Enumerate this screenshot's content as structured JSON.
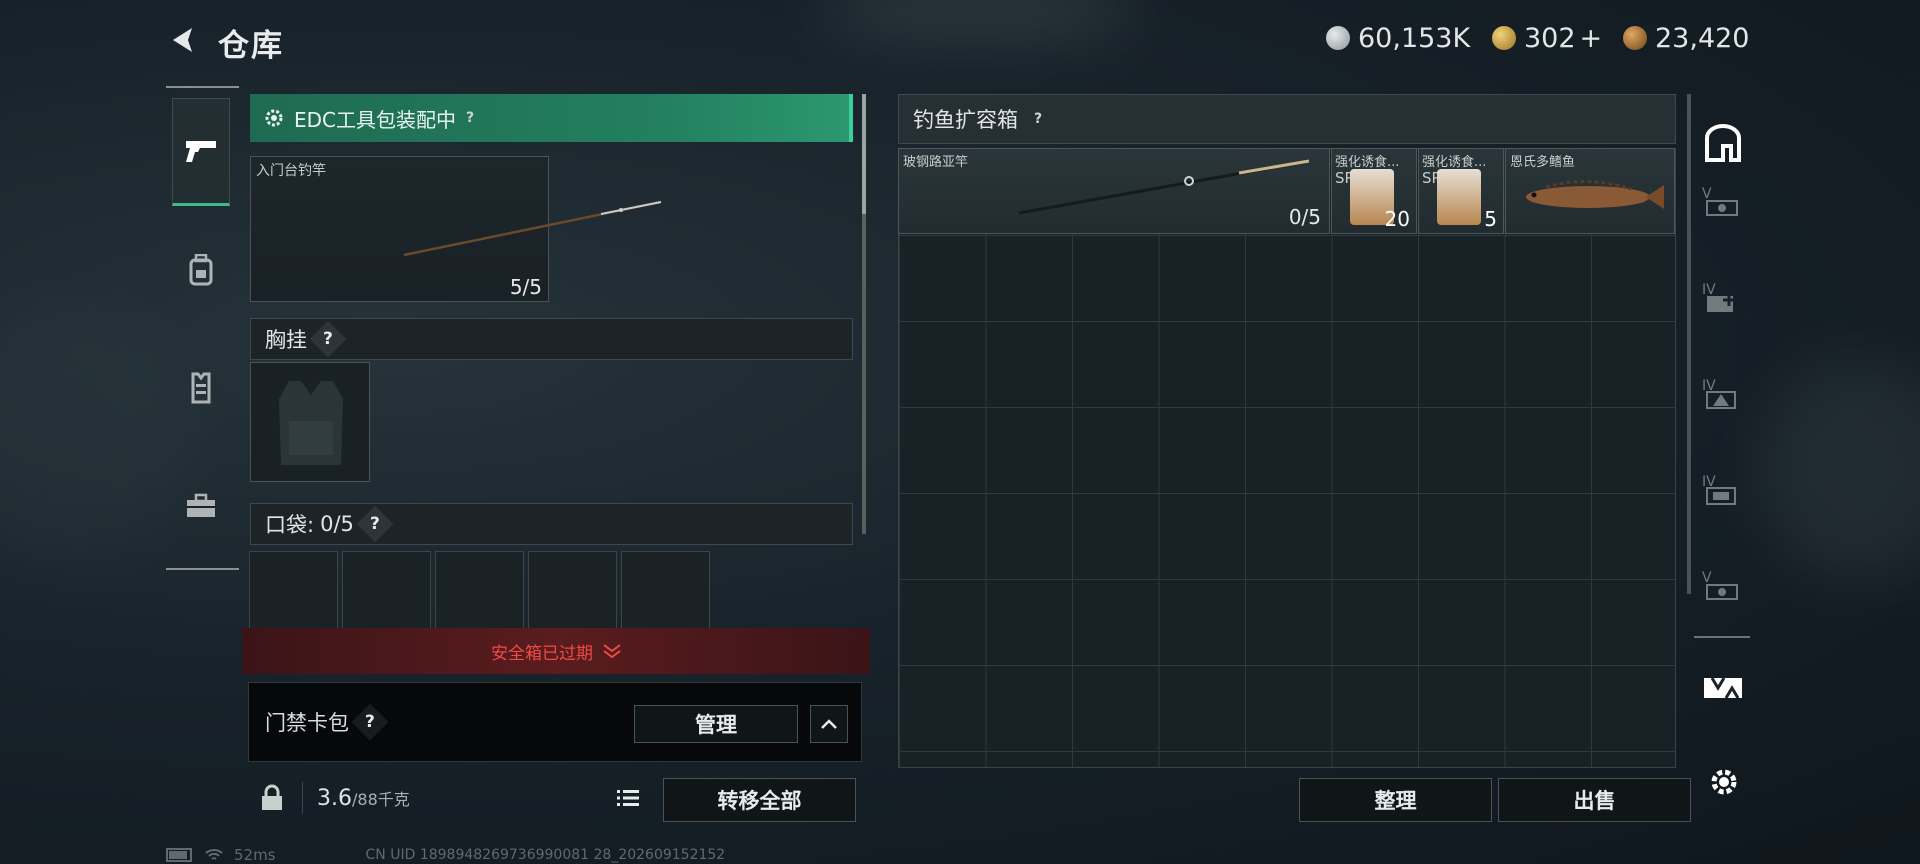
{
  "header": {
    "title": "仓库"
  },
  "currencies": [
    {
      "icon": "silver-coin-icon",
      "value": "60,153K",
      "color": "#b9bec0"
    },
    {
      "icon": "gold-coin-icon",
      "value": "302",
      "suffix": "+",
      "color": "#c9a040"
    },
    {
      "icon": "bronze-coin-icon",
      "value": "23,420",
      "color": "#b07f3c"
    }
  ],
  "side_tabs": [
    {
      "icon": "pistol-icon",
      "active": true
    },
    {
      "icon": "backpack-icon",
      "active": false
    },
    {
      "icon": "vest-icon",
      "active": false
    },
    {
      "icon": "toolbox-icon",
      "active": false
    }
  ],
  "equip": {
    "banner": "EDC工具包装配中",
    "help": "?",
    "rod": {
      "name": "入门台钓竿",
      "count": "5/5"
    },
    "chest": {
      "label": "胸挂",
      "help": "?"
    },
    "pockets": {
      "label": "口袋:",
      "count": "0/5",
      "help": "?"
    },
    "expired": "安全箱已过期",
    "keycard": {
      "label": "门禁卡包",
      "help": "?",
      "manage": "管理"
    },
    "weight": {
      "current": "3.6",
      "max": "/88千克"
    },
    "transfer_all": "转移全部"
  },
  "storage": {
    "title": "钓鱼扩容箱",
    "help": "?",
    "items": [
      {
        "name": "玻钢路亚竿",
        "count": "0/5"
      },
      {
        "name": "强化诱食...",
        "tag": "SP",
        "count": "20"
      },
      {
        "name": "强化诱食...",
        "tag": "SP",
        "count": "5"
      },
      {
        "name": "恩氏多鳍鱼",
        "count": ""
      }
    ],
    "sort_button": "整理",
    "sell_button": "出售"
  },
  "right_tabs": [
    {
      "icon": "cabinet-icon",
      "label": ""
    },
    {
      "icon": "slot-v-icon",
      "label": "V"
    },
    {
      "icon": "slot-iv-plus-icon",
      "label": "IV"
    },
    {
      "icon": "slot-iv-warning-icon",
      "label": "IV"
    },
    {
      "icon": "slot-iv-icon",
      "label": "IV"
    },
    {
      "icon": "slot-v2-icon",
      "label": "V"
    }
  ],
  "status": {
    "ping": "52ms",
    "uid": "CN UID 1898948269736990081 28_202609152152"
  }
}
